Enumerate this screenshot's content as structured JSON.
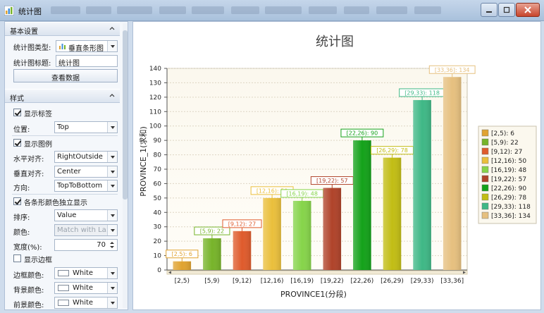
{
  "window": {
    "title": "统计图",
    "buttons": [
      "minimize",
      "maximize",
      "close"
    ]
  },
  "left_panel": {
    "basic_group": {
      "title": "基本设置",
      "chart_type_label": "统计图类型:",
      "chart_type_value": "垂直条形图",
      "chart_title_label": "统计图标题:",
      "chart_title_value": "统计图",
      "view_data_button": "查看数据"
    },
    "style_group": {
      "title": "样式",
      "show_labels": {
        "label": "显示标签",
        "checked": true
      },
      "position": {
        "label": "位置:",
        "value": "Top"
      },
      "show_legend": {
        "label": "显示图例",
        "checked": true
      },
      "h_align": {
        "label": "水平对齐:",
        "value": "RightOutside"
      },
      "v_align": {
        "label": "垂直对齐:",
        "value": "Center"
      },
      "direction": {
        "label": "方向:",
        "value": "TopToBottom"
      },
      "bar_color_independent": {
        "label": "各条形颜色独立显示",
        "checked": true
      },
      "sort": {
        "label": "排序:",
        "value": "Value"
      },
      "color": {
        "label": "颜色:",
        "value": "Match with La..."
      },
      "width": {
        "label": "宽度(%):",
        "value": "70"
      },
      "show_border": {
        "label": "显示边框",
        "checked": false
      },
      "border_color": {
        "label": "边框颜色:",
        "value": "White"
      },
      "back_color": {
        "label": "背景颜色:",
        "value": "White"
      },
      "fore_color": {
        "label": "前景颜色:",
        "value": "White"
      }
    }
  },
  "chart_data": {
    "type": "bar",
    "title": "统计图",
    "xlabel": "PROVINCE1(分段)",
    "ylabel": "PROVINCE_1(求和)",
    "ylim": [
      0,
      140
    ],
    "yticks": [
      0,
      10,
      20,
      30,
      40,
      50,
      60,
      70,
      80,
      90,
      100,
      110,
      120,
      130,
      140
    ],
    "grid": true,
    "legend_position": "right",
    "categories": [
      "[2,5)",
      "[5,9)",
      "[9,12)",
      "[12,16)",
      "[16,19)",
      "[19,22)",
      "[22,26)",
      "[26,29)",
      "[29,33)",
      "[33,36]"
    ],
    "values": [
      6,
      22,
      27,
      50,
      48,
      57,
      90,
      78,
      118,
      134
    ],
    "colors": [
      "#e0a331",
      "#77b42a",
      "#df5b2c",
      "#eabf3c",
      "#86d44a",
      "#b0432a",
      "#14a21a",
      "#c2bd14",
      "#3fb886",
      "#e6c07f"
    ],
    "data_labels": [
      "[2,5): 6",
      "[5,9): 22",
      "[9,12): 27",
      "[12,16): 50",
      "[16,19): 48",
      "[19,22): 57",
      "[22,26): 90",
      "[26,29): 78",
      "[29,33): 118",
      "[33,36]: 134"
    ],
    "legend_entries": [
      "[2,5): 6",
      "[5,9): 22",
      "[9,12): 27",
      "[12,16): 50",
      "[16,19): 48",
      "[19,22): 57",
      "[22,26): 90",
      "[26,29): 78",
      "[29,33): 118",
      "[33,36]: 134"
    ]
  }
}
